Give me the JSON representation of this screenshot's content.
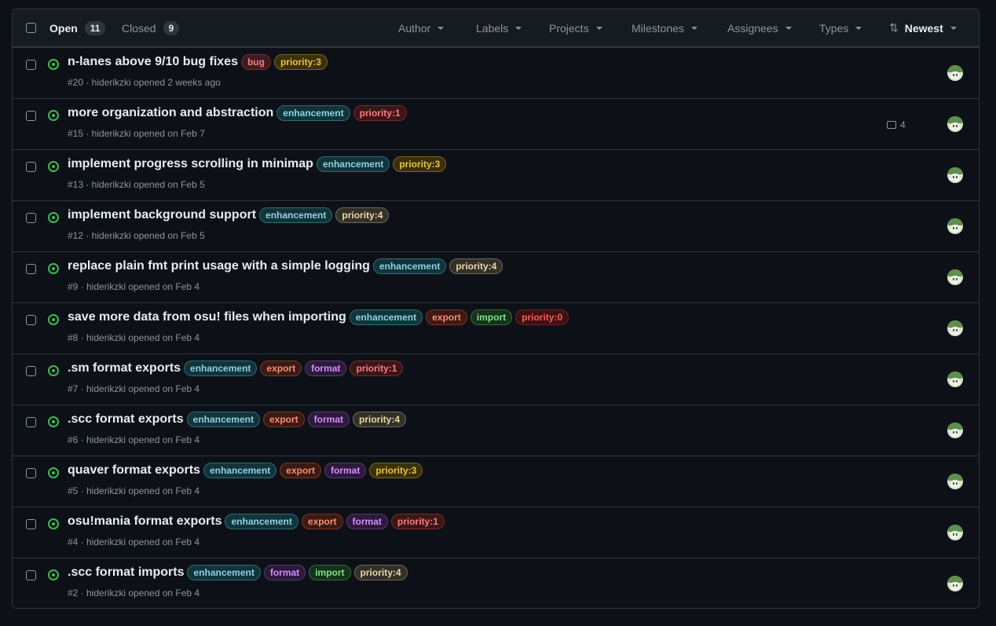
{
  "header": {
    "open_label": "Open",
    "open_count": "11",
    "closed_label": "Closed",
    "closed_count": "9",
    "filters": [
      "Author",
      "Labels",
      "Projects",
      "Milestones",
      "Assignees",
      "Types"
    ],
    "sort_label": "Newest"
  },
  "label_colors": {
    "bug": {
      "fg": "#f47b83",
      "bg": "#3b1d20",
      "border": "#7a2b33"
    },
    "enhancement": {
      "fg": "#8ad3e0",
      "bg": "#13333a",
      "border": "#2b6b78"
    },
    "priority:0": {
      "fg": "#ff5a5a",
      "bg": "#3a1214",
      "border": "#7a1e22"
    },
    "priority:1": {
      "fg": "#ff7b7b",
      "bg": "#3a1618",
      "border": "#7a2a2e"
    },
    "priority:3": {
      "fg": "#e8c33a",
      "bg": "#3a3010",
      "border": "#7a6418"
    },
    "priority:4": {
      "fg": "#e6d9a6",
      "bg": "#33302a",
      "border": "#6e6758"
    },
    "export": {
      "fg": "#ff8a70",
      "bg": "#3a1b14",
      "border": "#7a3424"
    },
    "import": {
      "fg": "#7ee08a",
      "bg": "#16321a",
      "border": "#2e6e36"
    },
    "format": {
      "fg": "#d48cff",
      "bg": "#2c1a3a",
      "border": "#5c3478"
    }
  },
  "issues": [
    {
      "title": "n-lanes above 9/10 bug fixes",
      "labels": [
        "bug",
        "priority:3"
      ],
      "meta": "#20 · hiderikzki opened 2 weeks ago",
      "comments": ""
    },
    {
      "title": "more organization and abstraction",
      "labels": [
        "enhancement",
        "priority:1"
      ],
      "meta": "#15 · hiderikzki opened on Feb 7",
      "comments": "4"
    },
    {
      "title": "implement progress scrolling in minimap",
      "labels": [
        "enhancement",
        "priority:3"
      ],
      "meta": "#13 · hiderikzki opened on Feb 5",
      "comments": ""
    },
    {
      "title": "implement background support",
      "labels": [
        "enhancement",
        "priority:4"
      ],
      "meta": "#12 · hiderikzki opened on Feb 5",
      "comments": ""
    },
    {
      "title": "replace plain fmt print usage with a simple logging",
      "labels": [
        "enhancement",
        "priority:4"
      ],
      "meta": "#9 · hiderikzki opened on Feb 4",
      "comments": ""
    },
    {
      "title": "save more data from osu! files when importing",
      "labels": [
        "enhancement",
        "export",
        "import",
        "priority:0"
      ],
      "meta": "#8 · hiderikzki opened on Feb 4",
      "comments": ""
    },
    {
      "title": ".sm format exports",
      "labels": [
        "enhancement",
        "export",
        "format",
        "priority:1"
      ],
      "meta": "#7 · hiderikzki opened on Feb 4",
      "comments": ""
    },
    {
      "title": ".scc format exports",
      "labels": [
        "enhancement",
        "export",
        "format",
        "priority:4"
      ],
      "meta": "#6 · hiderikzki opened on Feb 4",
      "comments": ""
    },
    {
      "title": "quaver format exports",
      "labels": [
        "enhancement",
        "export",
        "format",
        "priority:3"
      ],
      "meta": "#5 · hiderikzki opened on Feb 4",
      "comments": ""
    },
    {
      "title": "osu!mania format exports",
      "labels": [
        "enhancement",
        "export",
        "format",
        "priority:1"
      ],
      "meta": "#4 · hiderikzki opened on Feb 4",
      "comments": ""
    },
    {
      "title": ".scc format imports",
      "labels": [
        "enhancement",
        "format",
        "import",
        "priority:4"
      ],
      "meta": "#2 · hiderikzki opened on Feb 4",
      "comments": ""
    }
  ]
}
